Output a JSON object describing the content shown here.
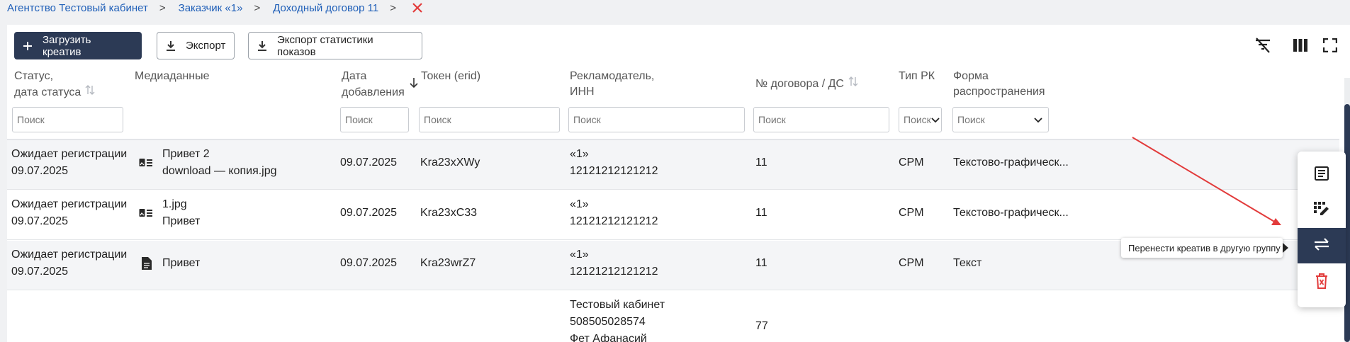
{
  "breadcrumb": {
    "items": [
      "Агентство Тестовый кабинет",
      "Заказчик «1»",
      "Доходный договор 11"
    ],
    "separator": ">"
  },
  "toolbar": {
    "upload_label": "Загрузить креатив",
    "export_label": "Экспорт",
    "export_stats_label": "Экспорт статистики показов"
  },
  "columns": {
    "status": [
      "Статус,",
      "дата статуса"
    ],
    "media": "Медиаданные",
    "date": [
      "Дата",
      "добавления"
    ],
    "token": "Токен (erid)",
    "advertiser": [
      "Рекламодатель,",
      "ИНН"
    ],
    "contract": "№ договора / ДС",
    "type": "Тип РК",
    "form": [
      "Форма",
      "распространения"
    ]
  },
  "filters": {
    "placeholder": "Поиск",
    "type_value": "Поиск",
    "form_value": "Поиск"
  },
  "rows": [
    {
      "status": "Ожидает регистрации",
      "status_date": "09.07.2025",
      "media_icon": "image-text-icon",
      "media_1": "Привет 2",
      "media_2": "download — копия.jpg",
      "date": "09.07.2025",
      "token": "Kra23xXWy",
      "adv_1": "«1»",
      "adv_2": "12121212121212",
      "contract": "11",
      "type": "CPM",
      "form": "Текстово-графическ..."
    },
    {
      "status": "Ожидает регистрации",
      "status_date": "09.07.2025",
      "media_icon": "image-text-icon",
      "media_1": "1.jpg",
      "media_2": "Привет",
      "date": "09.07.2025",
      "token": "Kra23xC33",
      "adv_1": "«1»",
      "adv_2": "12121212121212",
      "contract": "11",
      "type": "CPM",
      "form": "Текстово-графическ..."
    },
    {
      "status": "Ожидает регистрации",
      "status_date": "09.07.2025",
      "media_icon": "document-icon",
      "media_1": "Привет",
      "media_2": "",
      "date": "09.07.2025",
      "token": "Kra23wrZ7",
      "adv_1": "«1»",
      "adv_2": "12121212121212",
      "contract": "11",
      "type": "CPM",
      "form": "Текст"
    },
    {
      "status": "",
      "status_date": "",
      "media_1": "",
      "media_2": "",
      "date": "",
      "token": "",
      "adv_1": "Тестовый кабинет",
      "adv_2": "508505028574",
      "adv_3": "Фет Афанасий",
      "contract": "77",
      "type": "",
      "form": ""
    }
  ],
  "tooltip": "Перенести креатив в другую группу",
  "colors": {
    "primary": "#2c3a55",
    "link": "#1f5fb8",
    "danger": "#e23b3b"
  }
}
